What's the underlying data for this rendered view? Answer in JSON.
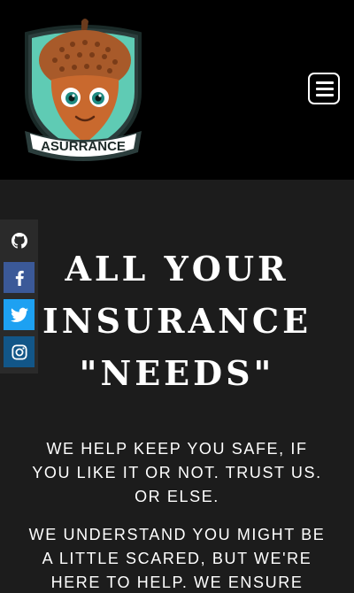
{
  "header": {
    "logo_text": "ASURRANCE",
    "menu_icon": "hamburger-menu-icon"
  },
  "social": [
    {
      "name": "github",
      "icon": "github-icon",
      "color": "#2a2a2a"
    },
    {
      "name": "facebook",
      "icon": "facebook-icon",
      "color": "#3b5998"
    },
    {
      "name": "twitter",
      "icon": "twitter-icon",
      "color": "#1da1f2"
    },
    {
      "name": "instagram",
      "icon": "instagram-icon",
      "color": "#125688"
    }
  ],
  "hero": {
    "title_line1": "ALL YOUR",
    "title_line2": "INSURANCE",
    "title_line3": "\"NEEDS\"",
    "paragraph1": "WE HELP KEEP YOU SAFE, IF YOU LIKE IT OR NOT. TRUST US. OR ELSE.",
    "paragraph2": "WE UNDERSTAND YOU MIGHT BE A LITTLE SCARED, BUT WE'RE HERE TO HELP. WE ENSURE"
  },
  "colors": {
    "header_bg": "#000000",
    "page_bg": "#1c1c1c",
    "shield_teal": "#5fcbb4",
    "acorn_brown": "#b05e2c"
  }
}
